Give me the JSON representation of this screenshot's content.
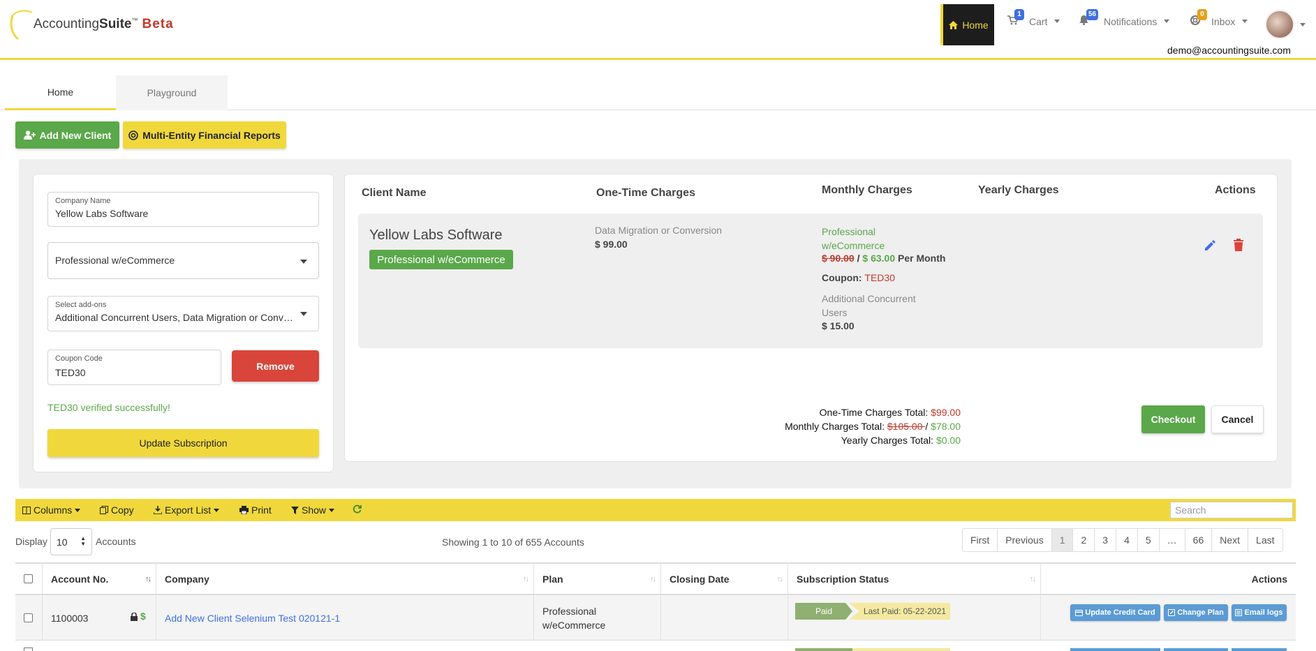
{
  "brand": {
    "name_plain": "Accounting",
    "name_bold": "Suite",
    "tm": "™",
    "beta": "Beta"
  },
  "nav": {
    "home": "Home",
    "cart": {
      "label": "Cart",
      "badge": "1"
    },
    "notifications": {
      "label": "Notifications",
      "badge": "56"
    },
    "inbox": {
      "label": "Inbox",
      "badge": "0"
    },
    "user_email": "demo@accountingsuite.com"
  },
  "tabs": [
    {
      "label": "Home"
    },
    {
      "label": "Playground"
    }
  ],
  "actions": {
    "add_client": "Add New Client",
    "multi_entity": "Multi-Entity Financial Reports"
  },
  "form": {
    "company_name_label": "Company Name",
    "company_name_value": "Yellow Labs Software",
    "plan_value": "Professional w/eCommerce",
    "addons_label": "Select add-ons",
    "addons_value": "Additional Concurrent Users, Data Migration or Conversion",
    "coupon_label": "Coupon Code",
    "coupon_value": "TED30",
    "remove_label": "Remove",
    "verified_msg": "TED30 verified successfully!",
    "update_label": "Update Subscription"
  },
  "summary": {
    "headers": {
      "client": "Client Name",
      "onetime": "One-Time Charges",
      "monthly": "Monthly Charges",
      "yearly": "Yearly Charges",
      "actions": "Actions"
    },
    "client_name": "Yellow Labs Software",
    "plan_pill": "Professional w/eCommerce",
    "onetime_item": "Data Migration or Conversion",
    "onetime_price": "$ 99.00",
    "monthly_plan_line1": "Professional",
    "monthly_plan_line2": "w/eCommerce",
    "monthly_old": "$ 90.00",
    "monthly_sep": " / ",
    "monthly_new": "$ 63.00",
    "monthly_per": " Per Month",
    "coupon_label": "Coupon: ",
    "coupon_value": "TED30",
    "addon_line1": "Additional Concurrent",
    "addon_line2": "Users",
    "addon_price": "$ 15.00",
    "totals": {
      "onetime_label": "One-Time Charges Total: ",
      "onetime_value": "$99.00",
      "monthly_label": "Monthly Charges Total: ",
      "monthly_old": "$105.00 ",
      "monthly_sep": "/ ",
      "monthly_new": "$78.00",
      "yearly_label": "Yearly Charges Total: ",
      "yearly_value": "$0.00"
    },
    "checkout": "Checkout",
    "cancel": "Cancel"
  },
  "toolbar": {
    "columns": "Columns",
    "copy": "Copy",
    "export": "Export List",
    "print": "Print",
    "show": "Show",
    "search_placeholder": "Search"
  },
  "table_controls": {
    "display": "Display",
    "length": "10",
    "accounts": "Accounts",
    "showing": "Showing 1 to 10 of 655 Accounts",
    "pager": [
      "First",
      "Previous",
      "1",
      "2",
      "3",
      "4",
      "5",
      "…",
      "66",
      "Next",
      "Last"
    ]
  },
  "table": {
    "headers": {
      "account": "Account No.",
      "company": "Company",
      "plan": "Plan",
      "closing": "Closing Date",
      "status": "Subscription Status",
      "actions": "Actions"
    },
    "rows": [
      {
        "account": "1100003",
        "company": "Add New Client Selenium Test 020121-1",
        "plan_line1": "Professional",
        "plan_line2": "w/eCommerce",
        "closing": "",
        "status": "Paid",
        "last_paid": "Last Paid: 05-22-2021",
        "btn_credit": "Update Credit Card",
        "btn_plan": "Change Plan",
        "btn_email": "Email logs"
      }
    ]
  },
  "colors": {
    "brand_yellow": "#f0d83c",
    "green": "#5aa84a",
    "red": "#d9453a",
    "blue": "#3f6fe0",
    "dark": "#1d1d1d"
  }
}
